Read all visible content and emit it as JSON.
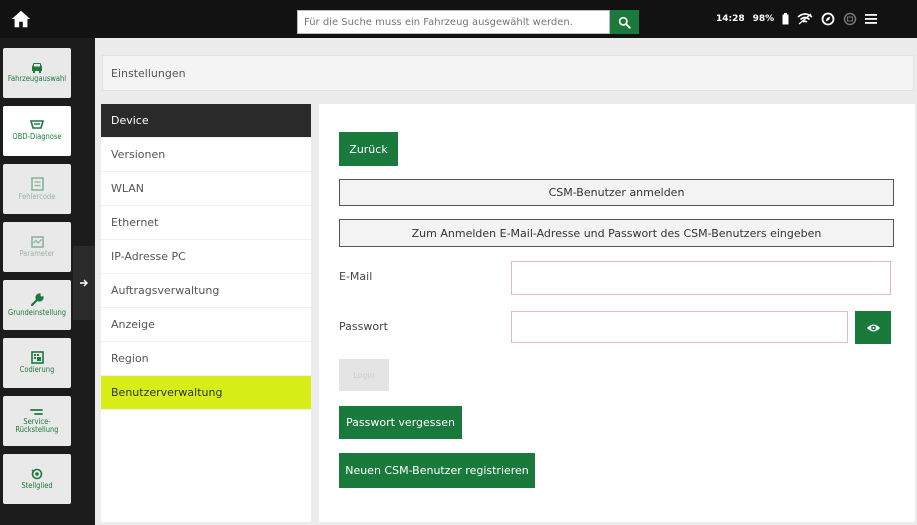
{
  "search": {
    "placeholder": "Für die Suche muss ein Fahrzeug ausgewählt werden."
  },
  "status": {
    "time": "14:28",
    "battery": "98%"
  },
  "nav": {
    "items": [
      {
        "label": "Fahrzeugauswahl",
        "icon": "car-icon"
      },
      {
        "label": "OBD-Diagnose",
        "icon": "obd-icon"
      },
      {
        "label": "Fehlercode",
        "icon": "fault-code-icon"
      },
      {
        "label": "Parameter",
        "icon": "parameter-icon"
      },
      {
        "label": "Grundeinstellung",
        "icon": "wrench-icon"
      },
      {
        "label": "Codierung",
        "icon": "coding-icon"
      },
      {
        "label": "Service-Rückstellung",
        "icon": "service-reset-icon"
      },
      {
        "label": "Stellglied",
        "icon": "actuator-icon"
      }
    ]
  },
  "breadcrumb": "Einstellungen",
  "menu": [
    "Device",
    "Versionen",
    "WLAN",
    "Ethernet",
    "IP-Adresse PC",
    "Auftragsverwaltung",
    "Anzeige",
    "Region",
    "Benutzerverwaltung"
  ],
  "panel": {
    "back_label": "Zurück",
    "login_header": "CSM-Benutzer anmelden",
    "info": "Zum Anmelden E-Mail-Adresse und Passwort des CSM-Benutzers eingeben",
    "email_label": "E-Mail",
    "email_value": "",
    "password_label": "Passwort",
    "password_value": "",
    "login_label": "Login",
    "forgot_label": "Passwort vergessen",
    "register_label": "Neuen CSM-Benutzer registrieren"
  },
  "colors": {
    "brand_green": "#1a7a3c",
    "highlight": "#d7ee19",
    "dark": "#1c1c1c"
  }
}
